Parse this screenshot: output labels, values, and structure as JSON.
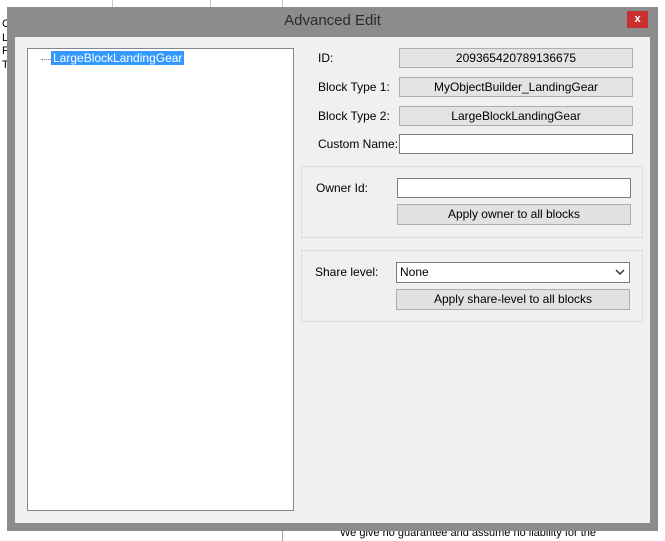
{
  "background": {
    "left_letters": [
      "C",
      "L",
      "F",
      "T"
    ],
    "bottom_text": "We give no guarantee and assume no liability for the"
  },
  "window": {
    "title": "Advanced Edit",
    "close_label": "x"
  },
  "tree": {
    "items": [
      {
        "label": "LargeBlockLandingGear",
        "selected": true
      }
    ]
  },
  "fields": {
    "id_label": "ID:",
    "id_value": "209365420789136675",
    "block_type1_label": "Block Type 1:",
    "block_type1_value": "MyObjectBuilder_LandingGear",
    "block_type2_label": "Block Type 2:",
    "block_type2_value": "LargeBlockLandingGear",
    "custom_name_label": "Custom Name:",
    "custom_name_value": ""
  },
  "owner_group": {
    "label": "Owner Id:",
    "value": "",
    "apply_button": "Apply owner to all blocks"
  },
  "share_group": {
    "label": "Share level:",
    "selected": "None",
    "apply_button": "Apply share-level to all blocks"
  }
}
